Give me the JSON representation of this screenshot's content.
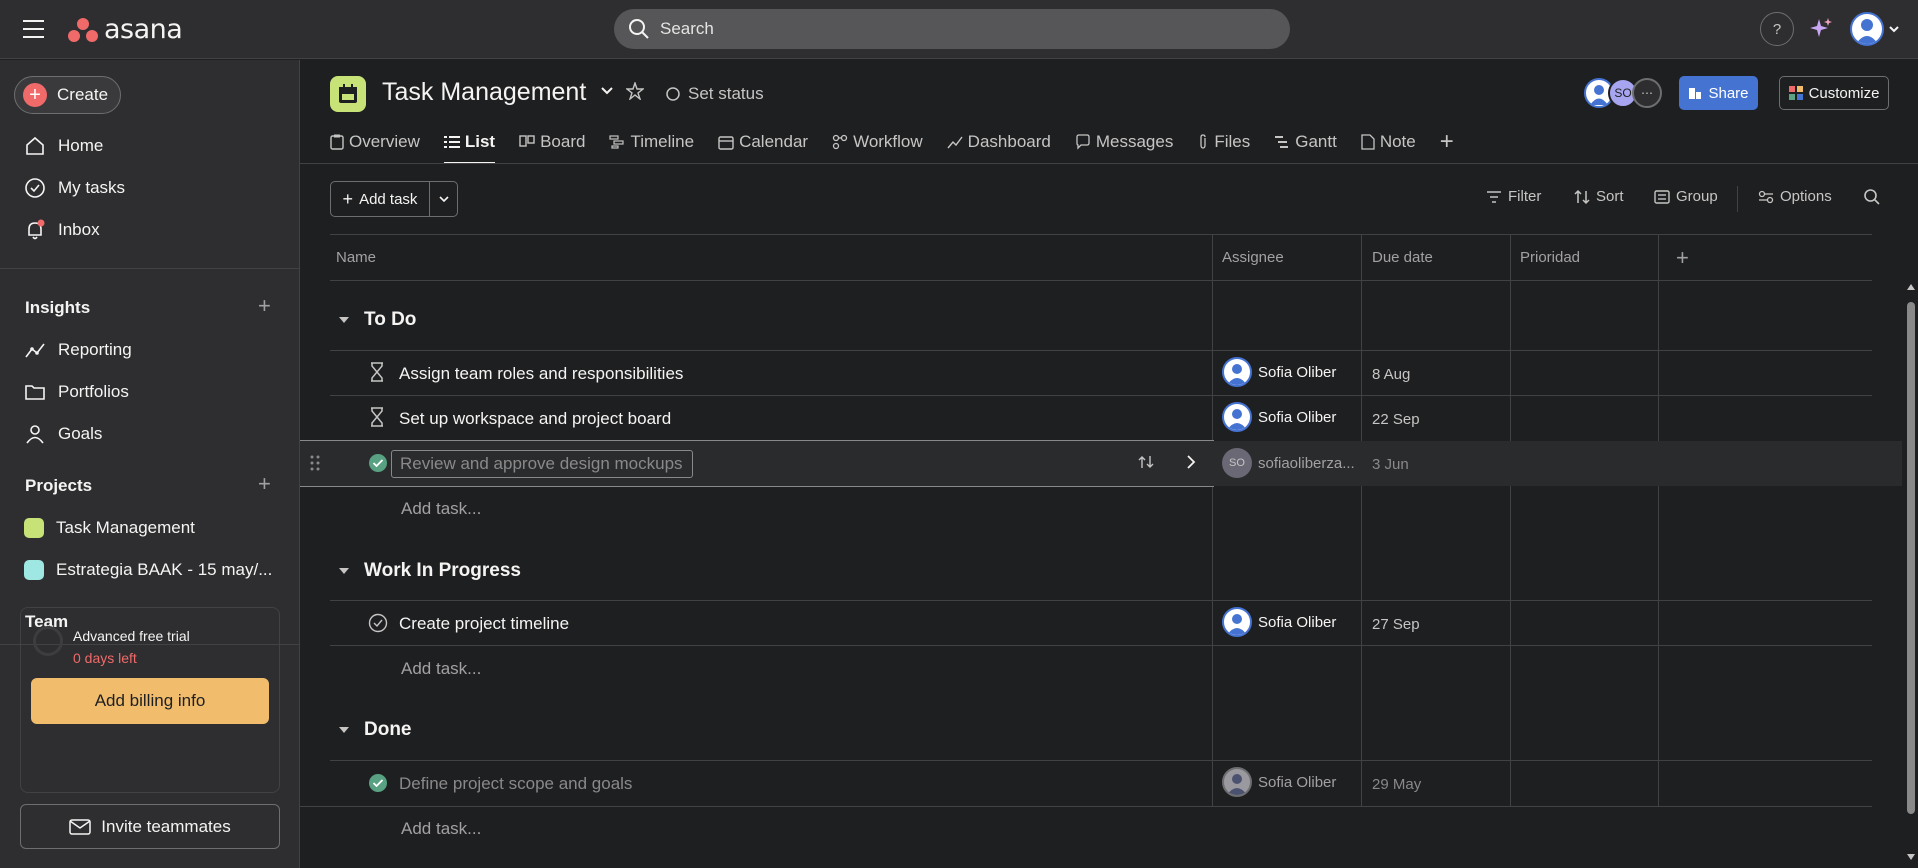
{
  "topbar": {
    "logo_text": "asana",
    "search_placeholder": "Search",
    "help_label": "?"
  },
  "sidebar": {
    "create_label": "Create",
    "nav": [
      {
        "label": "Home"
      },
      {
        "label": "My tasks"
      },
      {
        "label": "Inbox"
      }
    ],
    "insights_title": "Insights",
    "insights": [
      {
        "label": "Reporting"
      },
      {
        "label": "Portfolios"
      },
      {
        "label": "Goals"
      }
    ],
    "projects_title": "Projects",
    "projects": [
      {
        "label": "Task Management",
        "color": "#c7e378"
      },
      {
        "label": "Estrategia BAAK - 15 may/...",
        "color": "#9ee7e3"
      }
    ],
    "team_title": "Team",
    "trial": {
      "title": "Advanced free trial",
      "days": "0 days left",
      "billing_label": "Add billing info"
    },
    "invite_label": "Invite teammates"
  },
  "project": {
    "title": "Task Management",
    "set_status_label": "Set status",
    "member_initials": "SO",
    "share_label": "Share",
    "customize_label": "Customize"
  },
  "tabs": [
    {
      "label": "Overview",
      "icon": "clipboard-icon"
    },
    {
      "label": "List",
      "icon": "list-icon",
      "active": true
    },
    {
      "label": "Board",
      "icon": "board-icon"
    },
    {
      "label": "Timeline",
      "icon": "timeline-icon"
    },
    {
      "label": "Calendar",
      "icon": "calendar-icon"
    },
    {
      "label": "Workflow",
      "icon": "workflow-icon"
    },
    {
      "label": "Dashboard",
      "icon": "dashboard-icon"
    },
    {
      "label": "Messages",
      "icon": "message-icon"
    },
    {
      "label": "Files",
      "icon": "paperclip-icon"
    },
    {
      "label": "Gantt",
      "icon": "gantt-icon"
    },
    {
      "label": "Note",
      "icon": "note-icon"
    }
  ],
  "toolbar": {
    "add_task_label": "Add task",
    "filter_label": "Filter",
    "sort_label": "Sort",
    "group_label": "Group",
    "options_label": "Options"
  },
  "columns": {
    "name": "Name",
    "assignee": "Assignee",
    "due_date": "Due date",
    "priority": "Prioridad"
  },
  "groups": [
    {
      "title": "To Do",
      "tasks": [
        {
          "name": "Assign team roles and responsibilities",
          "assignee": "Sofia Oliber",
          "due": "8 Aug"
        },
        {
          "name": "Set up workspace and project board",
          "assignee": "Sofia Oliber",
          "due": "22 Sep"
        },
        {
          "name": "Review and approve design mockups",
          "assignee": "sofiaoliberza...",
          "due": "3 Jun"
        }
      ],
      "add_task_label": "Add task..."
    },
    {
      "title": "Work In Progress",
      "tasks": [
        {
          "name": "Create project timeline",
          "assignee": "Sofia Oliber",
          "due": "27 Sep"
        }
      ],
      "add_task_label": "Add task..."
    },
    {
      "title": "Done",
      "tasks": [
        {
          "name": "Define project scope and goals",
          "assignee": "Sofia Oliber",
          "due": "29 May"
        }
      ],
      "add_task_label": "Add task..."
    }
  ],
  "colors": {
    "accent": "#4573d2",
    "create": "#f06a6a",
    "billing": "#f1bd6c",
    "done_check": "#58a182"
  }
}
